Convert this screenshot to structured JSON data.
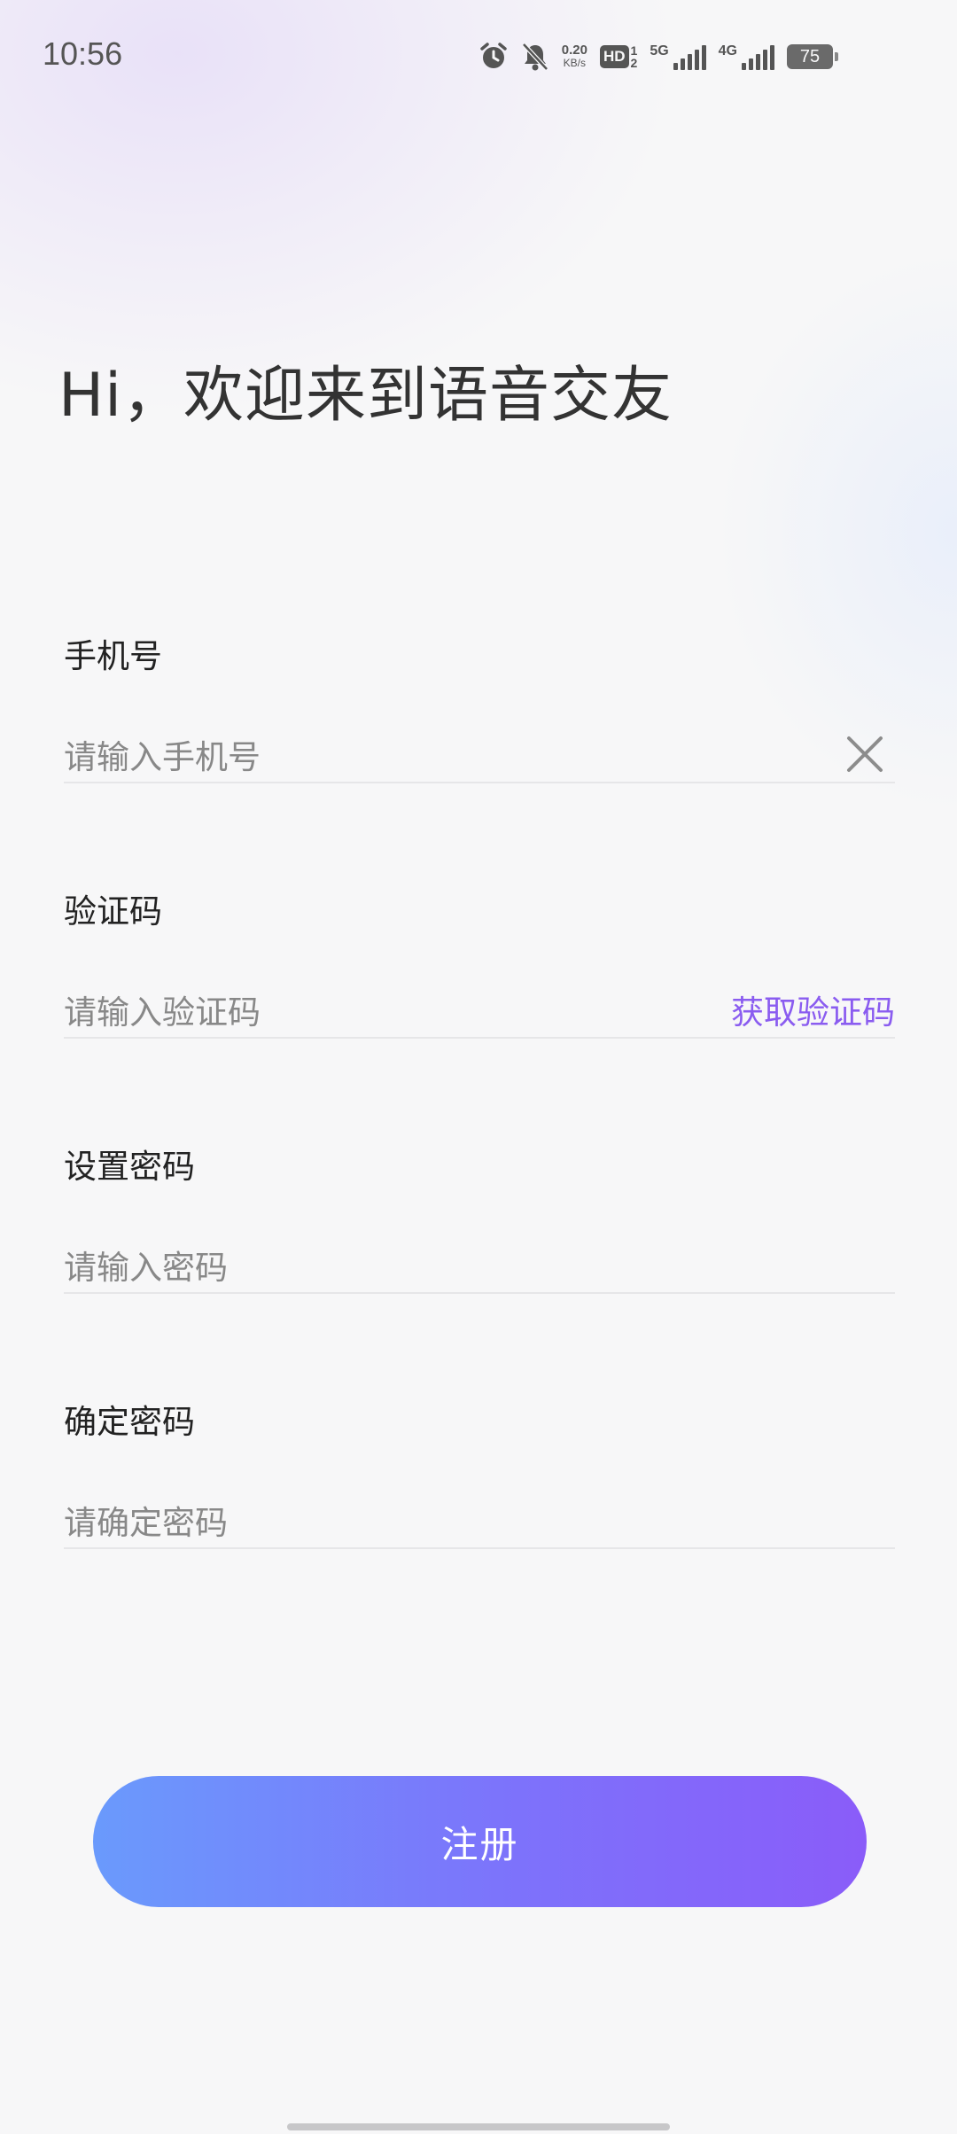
{
  "status_bar": {
    "time": "10:56",
    "net_speed_value": "0.20",
    "net_speed_unit": "KB/s",
    "hd_label": "HD",
    "hd_sub_top": "1",
    "hd_sub_bottom": "2",
    "network_1": "5G",
    "network_2": "4G",
    "battery": "75",
    "icons": [
      "alarm-icon",
      "mute-notification-icon"
    ]
  },
  "header": {
    "title": "Hi，欢迎来到语音交友"
  },
  "form": {
    "phone": {
      "label": "手机号",
      "placeholder": "请输入手机号"
    },
    "code": {
      "label": "验证码",
      "placeholder": "请输入验证码",
      "action": "获取验证码"
    },
    "password": {
      "label": "设置密码",
      "placeholder": "请输入密码"
    },
    "confirm": {
      "label": "确定密码",
      "placeholder": "请确定密码"
    },
    "submit_label": "注册"
  },
  "colors": {
    "accent": "#8a5cf0",
    "button_gradient_start": "#6a9afc",
    "button_gradient_end": "#8a5cf9"
  }
}
